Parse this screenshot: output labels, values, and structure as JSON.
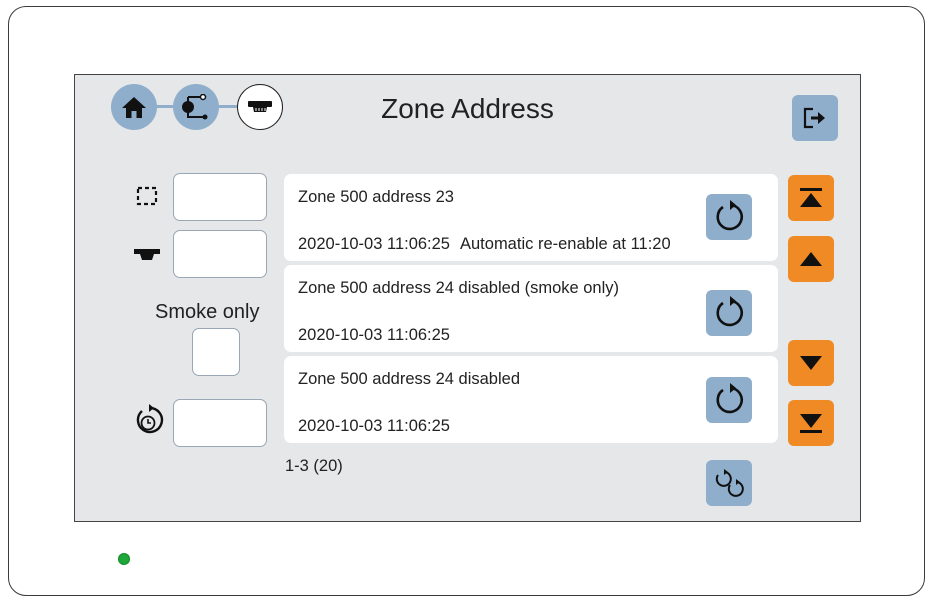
{
  "header": {
    "title": "Zone Address"
  },
  "breadcrumb": [
    "home-icon",
    "loop-address-icon",
    "detector-icon"
  ],
  "filters": {
    "zone_value": "",
    "address_value": "",
    "smoke_only_label": "Smoke only",
    "smoke_only_checked": false,
    "reenable_time_value": ""
  },
  "events": [
    {
      "line1": "Zone 500 address 23",
      "timestamp": "2020-10-03 11:06:25",
      "extra": "Automatic re-enable at 11:20"
    },
    {
      "line1": "Zone 500 address 24 disabled (smoke only)",
      "timestamp": "2020-10-03 11:06:25",
      "extra": ""
    },
    {
      "line1": "Zone 500 address 24 disabled",
      "timestamp": "2020-10-03 11:06:25",
      "extra": ""
    }
  ],
  "pagination": {
    "count_label": "1-3 (20)"
  },
  "colors": {
    "accent_blue": "#8eaecb",
    "accent_orange": "#f08a24",
    "status_led": "#1fa83a"
  }
}
